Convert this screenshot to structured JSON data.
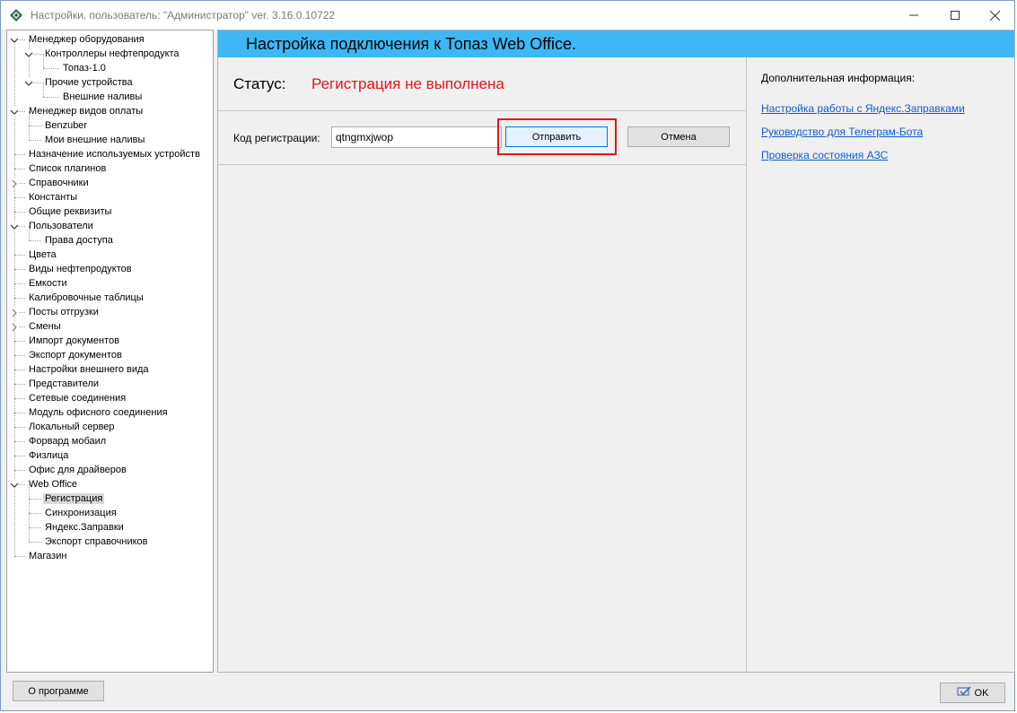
{
  "window": {
    "title": "Настройки. пользователь: \"Администратор\" ver. 3.16.0.10722"
  },
  "tree": {
    "nodes": [
      {
        "label": "Менеджер оборудования",
        "level": 0,
        "expander": "expanded"
      },
      {
        "label": "Контроллеры нефтепродукта",
        "level": 1,
        "expander": "expanded"
      },
      {
        "label": "Топаз-1.0",
        "level": 2,
        "expander": "none"
      },
      {
        "label": "Прочие устройства",
        "level": 1,
        "expander": "expanded"
      },
      {
        "label": "Внешние наливы",
        "level": 2,
        "expander": "none"
      },
      {
        "label": "Менеджер видов оплаты",
        "level": 0,
        "expander": "expanded"
      },
      {
        "label": "Benzuber",
        "level": 1,
        "expander": "none"
      },
      {
        "label": "Мои внешние наливы",
        "level": 1,
        "expander": "none"
      },
      {
        "label": "Назначение используемых устройств",
        "level": 0,
        "expander": "none"
      },
      {
        "label": "Список плагинов",
        "level": 0,
        "expander": "none"
      },
      {
        "label": "Справочники",
        "level": 0,
        "expander": "collapsed"
      },
      {
        "label": "Константы",
        "level": 0,
        "expander": "none"
      },
      {
        "label": "Общие реквизиты",
        "level": 0,
        "expander": "none"
      },
      {
        "label": "Пользователи",
        "level": 0,
        "expander": "expanded"
      },
      {
        "label": "Права доступа",
        "level": 1,
        "expander": "none"
      },
      {
        "label": "Цвета",
        "level": 0,
        "expander": "none"
      },
      {
        "label": "Виды нефтепродуктов",
        "level": 0,
        "expander": "none"
      },
      {
        "label": "Емкости",
        "level": 0,
        "expander": "none"
      },
      {
        "label": "Калибровочные таблицы",
        "level": 0,
        "expander": "none"
      },
      {
        "label": "Посты отгрузки",
        "level": 0,
        "expander": "collapsed"
      },
      {
        "label": "Смены",
        "level": 0,
        "expander": "collapsed"
      },
      {
        "label": "Импорт документов",
        "level": 0,
        "expander": "none"
      },
      {
        "label": "Экспорт документов",
        "level": 0,
        "expander": "none"
      },
      {
        "label": "Настройки внешнего вида",
        "level": 0,
        "expander": "none"
      },
      {
        "label": "Представители",
        "level": 0,
        "expander": "none"
      },
      {
        "label": "Сетевые соединения",
        "level": 0,
        "expander": "none"
      },
      {
        "label": "Модуль офисного соединения",
        "level": 0,
        "expander": "none"
      },
      {
        "label": "Локальный сервер",
        "level": 0,
        "expander": "none"
      },
      {
        "label": "Форвард мобаил",
        "level": 0,
        "expander": "none"
      },
      {
        "label": "Физлица",
        "level": 0,
        "expander": "none"
      },
      {
        "label": "Офис для драйверов",
        "level": 0,
        "expander": "none"
      },
      {
        "label": "Web Office",
        "level": 0,
        "expander": "expanded"
      },
      {
        "label": "Регистрация",
        "level": 1,
        "expander": "none",
        "selected": true
      },
      {
        "label": "Синхронизация",
        "level": 1,
        "expander": "none"
      },
      {
        "label": "Яндекс.Заправки",
        "level": 1,
        "expander": "none"
      },
      {
        "label": "Экспорт справочников",
        "level": 1,
        "expander": "none"
      },
      {
        "label": "Магазин",
        "level": 0,
        "expander": "none"
      }
    ]
  },
  "main": {
    "header_title": "Настройка подключения к Топаз Web Office.",
    "status_label": "Статус:",
    "status_value": "Регистрация не выполнена",
    "reg_label": "Код регистрации:",
    "reg_value": "qtngmxjwop",
    "send_label": "Отправить",
    "cancel_label": "Отмена"
  },
  "info": {
    "title": "Дополнительная информация:",
    "links": [
      "Настройка работы с Яндекс.Заправками",
      "Руководство для Телеграм-Бота",
      "Проверка состояния АЗС"
    ]
  },
  "footer": {
    "about_label": "О программе",
    "ok_label": "OK"
  },
  "colors": {
    "header_bg": "#3db8f5",
    "status_error": "#e41616",
    "link": "#0f5bd2",
    "highlight": "#e41616"
  }
}
